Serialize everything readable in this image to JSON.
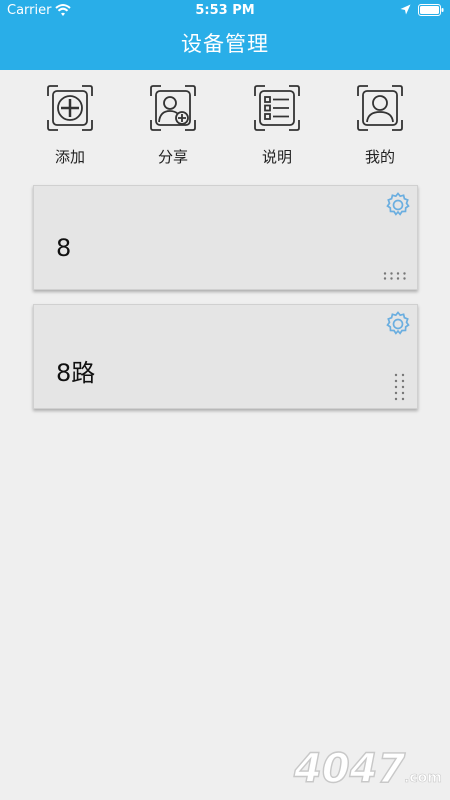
{
  "status_bar": {
    "carrier": "Carrier",
    "time": "5:53 PM"
  },
  "header": {
    "title": "设备管理"
  },
  "actions": [
    {
      "label": "添加",
      "icon": "add-icon"
    },
    {
      "label": "分享",
      "icon": "share-user-icon"
    },
    {
      "label": "说明",
      "icon": "list-icon"
    },
    {
      "label": "我的",
      "icon": "profile-icon"
    }
  ],
  "devices": [
    {
      "name": "8",
      "grid_icon": "dots-horizontal-icon"
    },
    {
      "name": "8路",
      "grid_icon": "dots-vertical-icon"
    }
  ],
  "watermark": {
    "text": "4047.com"
  },
  "colors": {
    "header_bg": "#29aee8",
    "gear": "#6aaee0",
    "card_bg": "#e5e5e5",
    "page_bg": "#efefef"
  }
}
